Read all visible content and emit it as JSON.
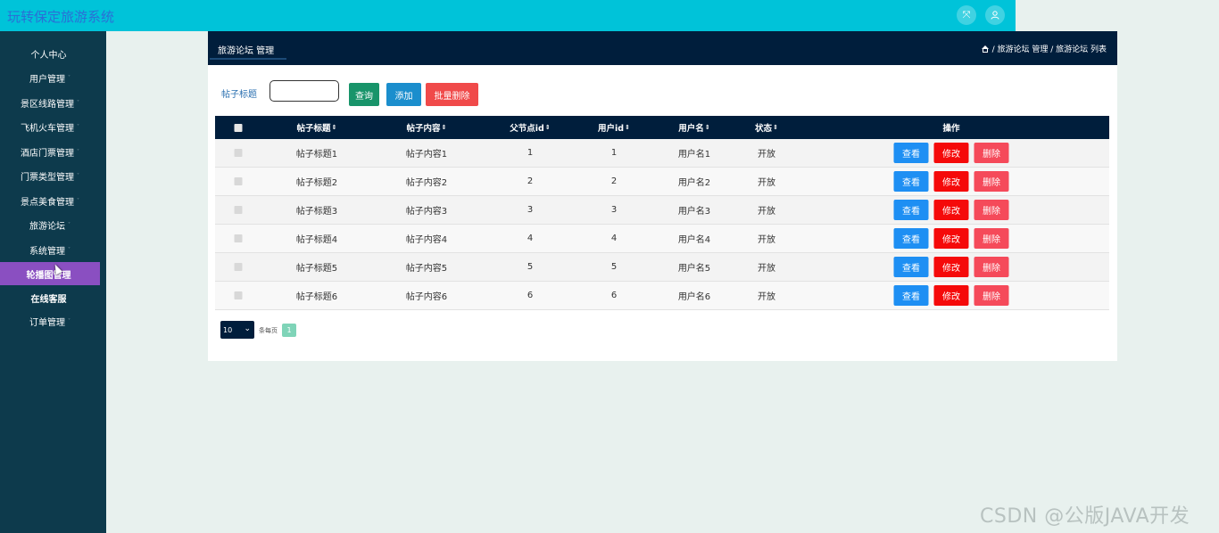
{
  "app": {
    "title": "玩转保定旅游系统"
  },
  "topbar": {
    "fullscreen_icon": "fullscreen-icon",
    "user_icon": "user-icon"
  },
  "sidebar": {
    "items": [
      {
        "label": "个人中心",
        "caret": ""
      },
      {
        "label": "用户管理",
        "caret": "˅"
      },
      {
        "label": "景区线路管理",
        "caret": "˅"
      },
      {
        "label": "飞机火车管理",
        "caret": "˅"
      },
      {
        "label": "酒店门票管理",
        "caret": "˅"
      },
      {
        "label": "门票类型管理",
        "caret": "˅"
      },
      {
        "label": "景点美食管理",
        "caret": "˅"
      },
      {
        "label": "旅游论坛",
        "caret": "˅"
      },
      {
        "label": "系统管理",
        "caret": "˅"
      },
      {
        "label": "轮播图管理",
        "caret": ""
      },
      {
        "label": "在线客服",
        "caret": ""
      },
      {
        "label": "订单管理",
        "caret": "˅"
      }
    ],
    "active_index": 9,
    "active_color": "#8a4fc1"
  },
  "header": {
    "title": "旅游论坛 管理",
    "breadcrumb": "/ 旅游论坛 管理 / 旅游论坛 列表"
  },
  "search": {
    "label": "帖子标题",
    "value": "",
    "query_label": "查询",
    "add_label": "添加",
    "batch_delete_label": "批量删除"
  },
  "table": {
    "columns": [
      "帖子标题",
      "帖子内容",
      "父节点id",
      "用户id",
      "用户名",
      "状态",
      "操作"
    ],
    "sort_icon": "⇕",
    "rows": [
      {
        "title": "帖子标题1",
        "content": "帖子内容1",
        "parent_id": "1",
        "user_id": "1",
        "username": "用户名1",
        "status": "开放"
      },
      {
        "title": "帖子标题2",
        "content": "帖子内容2",
        "parent_id": "2",
        "user_id": "2",
        "username": "用户名2",
        "status": "开放"
      },
      {
        "title": "帖子标题3",
        "content": "帖子内容3",
        "parent_id": "3",
        "user_id": "3",
        "username": "用户名3",
        "status": "开放"
      },
      {
        "title": "帖子标题4",
        "content": "帖子内容4",
        "parent_id": "4",
        "user_id": "4",
        "username": "用户名4",
        "status": "开放"
      },
      {
        "title": "帖子标题5",
        "content": "帖子内容5",
        "parent_id": "5",
        "user_id": "5",
        "username": "用户名5",
        "status": "开放"
      },
      {
        "title": "帖子标题6",
        "content": "帖子内容6",
        "parent_id": "6",
        "user_id": "6",
        "username": "用户名6",
        "status": "开放"
      }
    ],
    "actions": {
      "view": "查看",
      "edit": "修改",
      "delete": "删除"
    }
  },
  "pagination": {
    "page_size": "10",
    "per_page_text": "条每页",
    "current_page": "1"
  },
  "watermark": "CSDN @公版JAVA开发"
}
